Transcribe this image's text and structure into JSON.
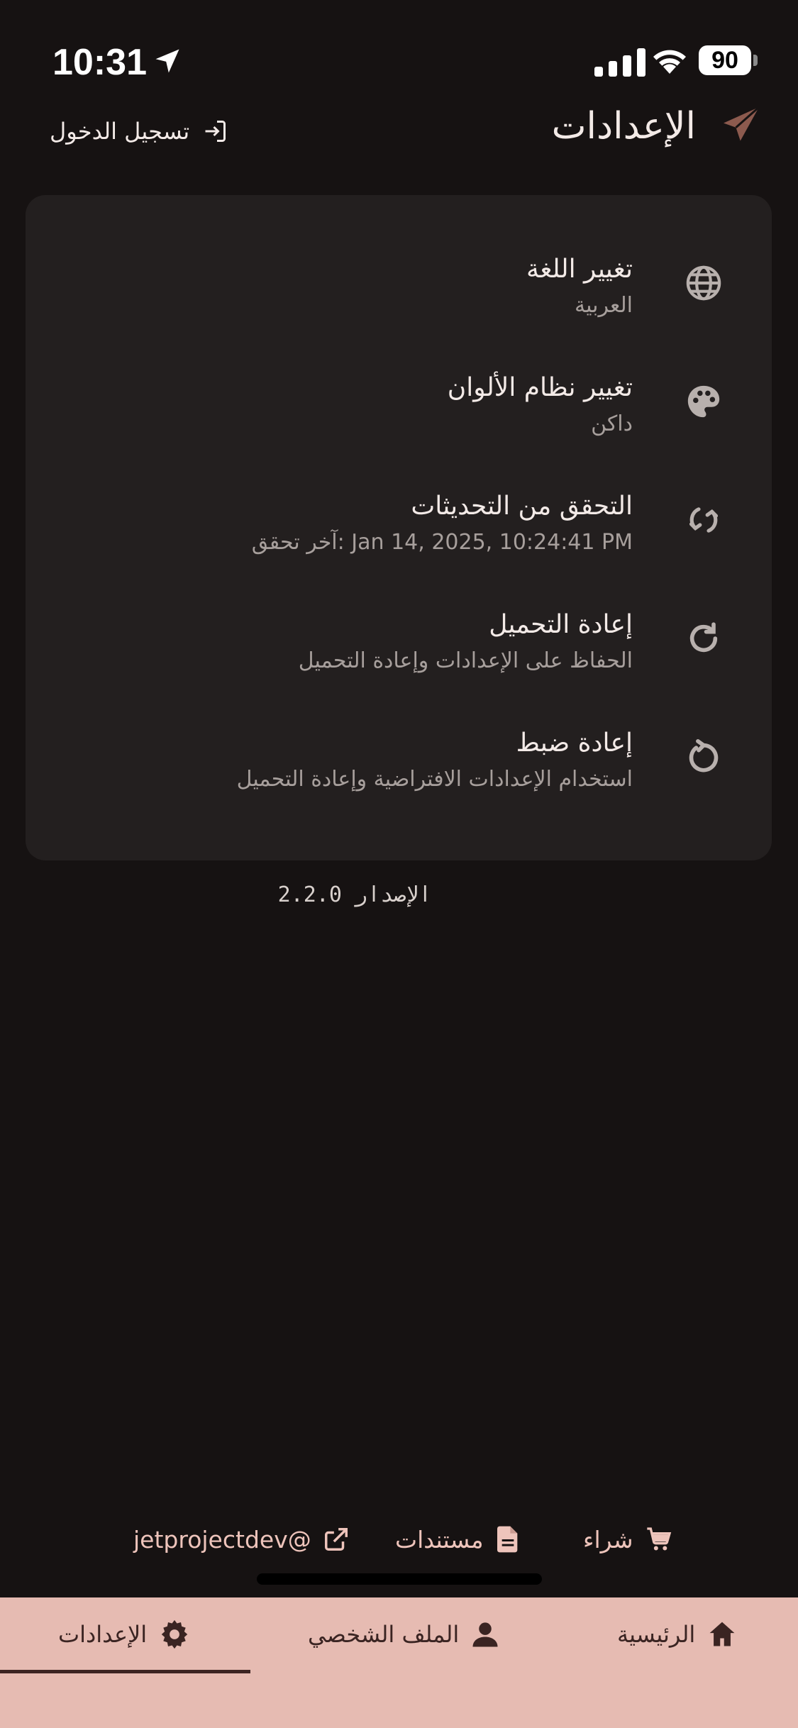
{
  "status_bar": {
    "time": "10:31",
    "battery": "90"
  },
  "header": {
    "title": "الإعدادات",
    "login_label": "تسجيل الدخول"
  },
  "settings": [
    {
      "icon": "globe-icon",
      "title": "تغيير اللغة",
      "subtitle": "العربية"
    },
    {
      "icon": "palette-icon",
      "title": "تغيير نظام الألوان",
      "subtitle": "داكن"
    },
    {
      "icon": "sync-icon",
      "title": "التحقق من التحديثات",
      "subtitle": "آخر تحقق: Jan 14, 2025, 10:24:41 PM"
    },
    {
      "icon": "reload-icon",
      "title": "إعادة التحميل",
      "subtitle": "الحفاظ على الإعدادات وإعادة التحميل"
    },
    {
      "icon": "reset-icon",
      "title": "إعادة ضبط",
      "subtitle": "استخدام الإعدادات الافتراضية وإعادة التحميل"
    }
  ],
  "version_text": "الإصدار 2.2.0",
  "links": {
    "buy": "شراء",
    "docs": "مستندات",
    "handle": "jetprojectdev@"
  },
  "nav": {
    "home": "الرئيسية",
    "profile": "الملف الشخصي",
    "settings": "الإعدادات"
  },
  "colors": {
    "background": "#161212",
    "card": "#231f1f",
    "accent": "#e6bbb2",
    "link": "#eec4bb"
  }
}
